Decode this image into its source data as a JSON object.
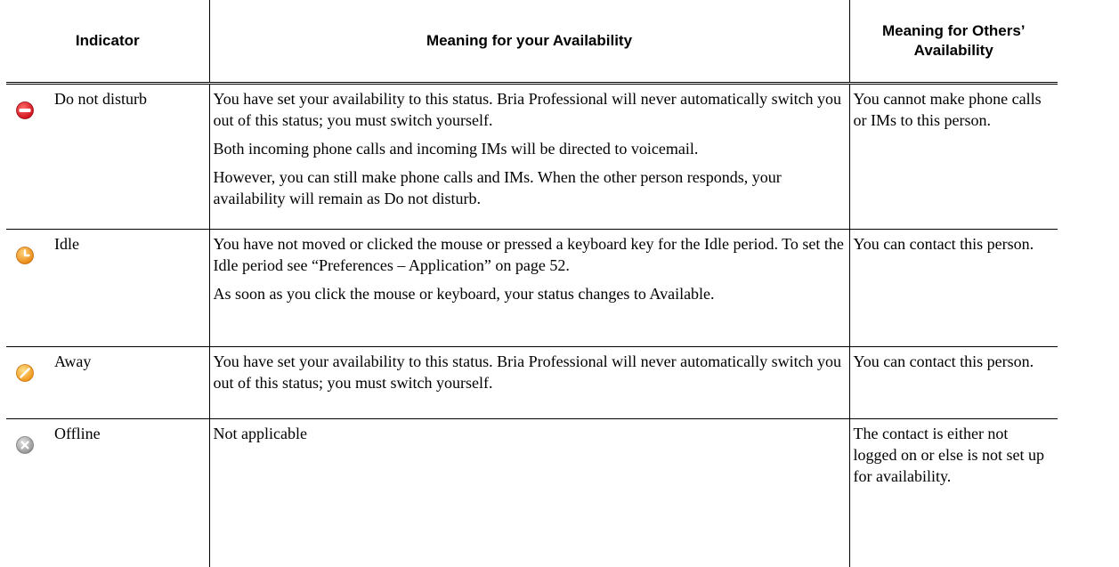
{
  "headers": {
    "indicator": "Indicator",
    "yours": "Meaning for your Availability",
    "others": "Meaning for Others’ Availability"
  },
  "rows": [
    {
      "icon": "do-not-disturb-icon",
      "label": "Do not disturb",
      "yours": [
        "You have set your availability to this status. Bria Professional will never automatically switch you out of this status; you must switch yourself.",
        "Both incoming phone calls and incoming IMs will be directed to voicemail.",
        "However, you can still make phone calls and IMs. When the other person responds, your availability will remain as Do not disturb."
      ],
      "others": "You cannot make phone calls or IMs to this person."
    },
    {
      "icon": "idle-icon",
      "label": "Idle",
      "yours": [
        "You have not moved or clicked the mouse or pressed a keyboard key for the Idle period. To set the Idle period see “Preferences – Application” on page 52.",
        "As soon as you click the mouse or keyboard, your status changes to Available."
      ],
      "others": "You can contact this person."
    },
    {
      "icon": "away-icon",
      "label": "Away",
      "yours": [
        "You have set your availability to this status. Bria Professional will never automatically switch you out of this status; you must switch yourself."
      ],
      "others": "You can contact this person."
    },
    {
      "icon": "offline-icon",
      "label": "Offline",
      "yours": [
        "Not applicable"
      ],
      "others": "The contact is either not logged on or else is not set up for availability."
    }
  ],
  "colors": {
    "dnd_red": "#e0141e",
    "idle_orange": "#f59a1a",
    "away_orange": "#f7a51e",
    "offline_gray": "#a8a8a8"
  }
}
